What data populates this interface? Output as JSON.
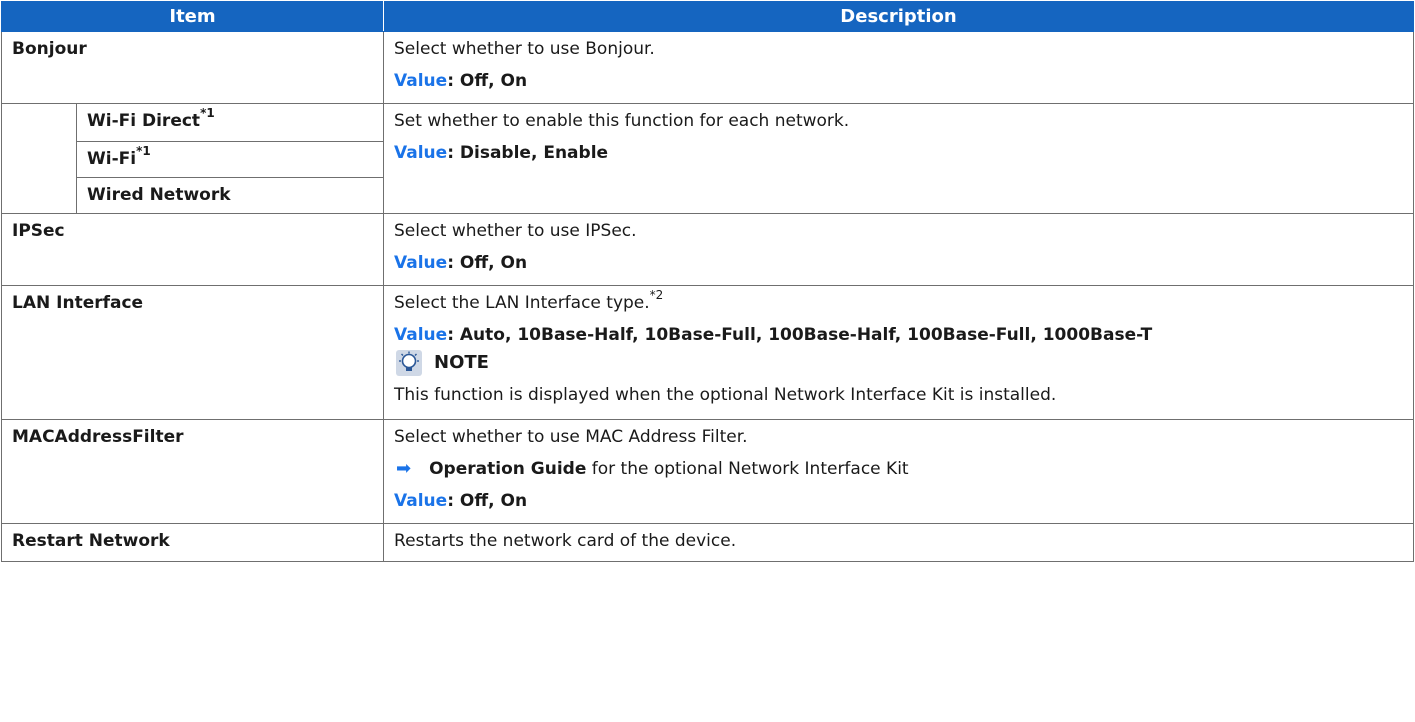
{
  "header": {
    "item": "Item",
    "description": "Description"
  },
  "bonjour": {
    "item": "Bonjour",
    "desc": "Select whether to use Bonjour.",
    "value_label": "Value",
    "value_text": ": Off, On"
  },
  "networks": {
    "wifi_direct": "Wi-Fi Direct",
    "wifi_direct_sup": "*1",
    "wifi": "Wi-Fi",
    "wifi_sup": "*1",
    "wired": "Wired Network",
    "desc": "Set whether to enable this function for each network.",
    "value_label": "Value",
    "value_text": ": Disable, Enable"
  },
  "ipsec": {
    "item": "IPSec",
    "desc": "Select whether to use IPSec.",
    "value_label": "Value",
    "value_text": ": Off, On"
  },
  "lan": {
    "item": "LAN Interface",
    "desc": "Select the LAN Interface type.",
    "desc_sup": "*2",
    "value_label": "Value",
    "value_text": ": Auto, 10Base-Half, 10Base-Full, 100Base-Half, 100Base-Full, 1000Base-T",
    "note_label": "NOTE",
    "note_icon": "lightbulb-note-icon",
    "note_text": "This function is displayed when the optional Network Interface Kit is installed."
  },
  "mac": {
    "item": "MACAddressFilter",
    "desc": "Select whether to use MAC Address Filter.",
    "ref_bold": "Operation Guide",
    "ref_text": " for the optional Network Interface Kit",
    "value_label": "Value",
    "value_text": ": Off, On"
  },
  "restart": {
    "item": "Restart Network",
    "desc": "Restarts the network card of the device."
  },
  "colors": {
    "header_bg": "#1565c0",
    "value_label": "#1a73e8",
    "border": "#6f6f6f"
  }
}
